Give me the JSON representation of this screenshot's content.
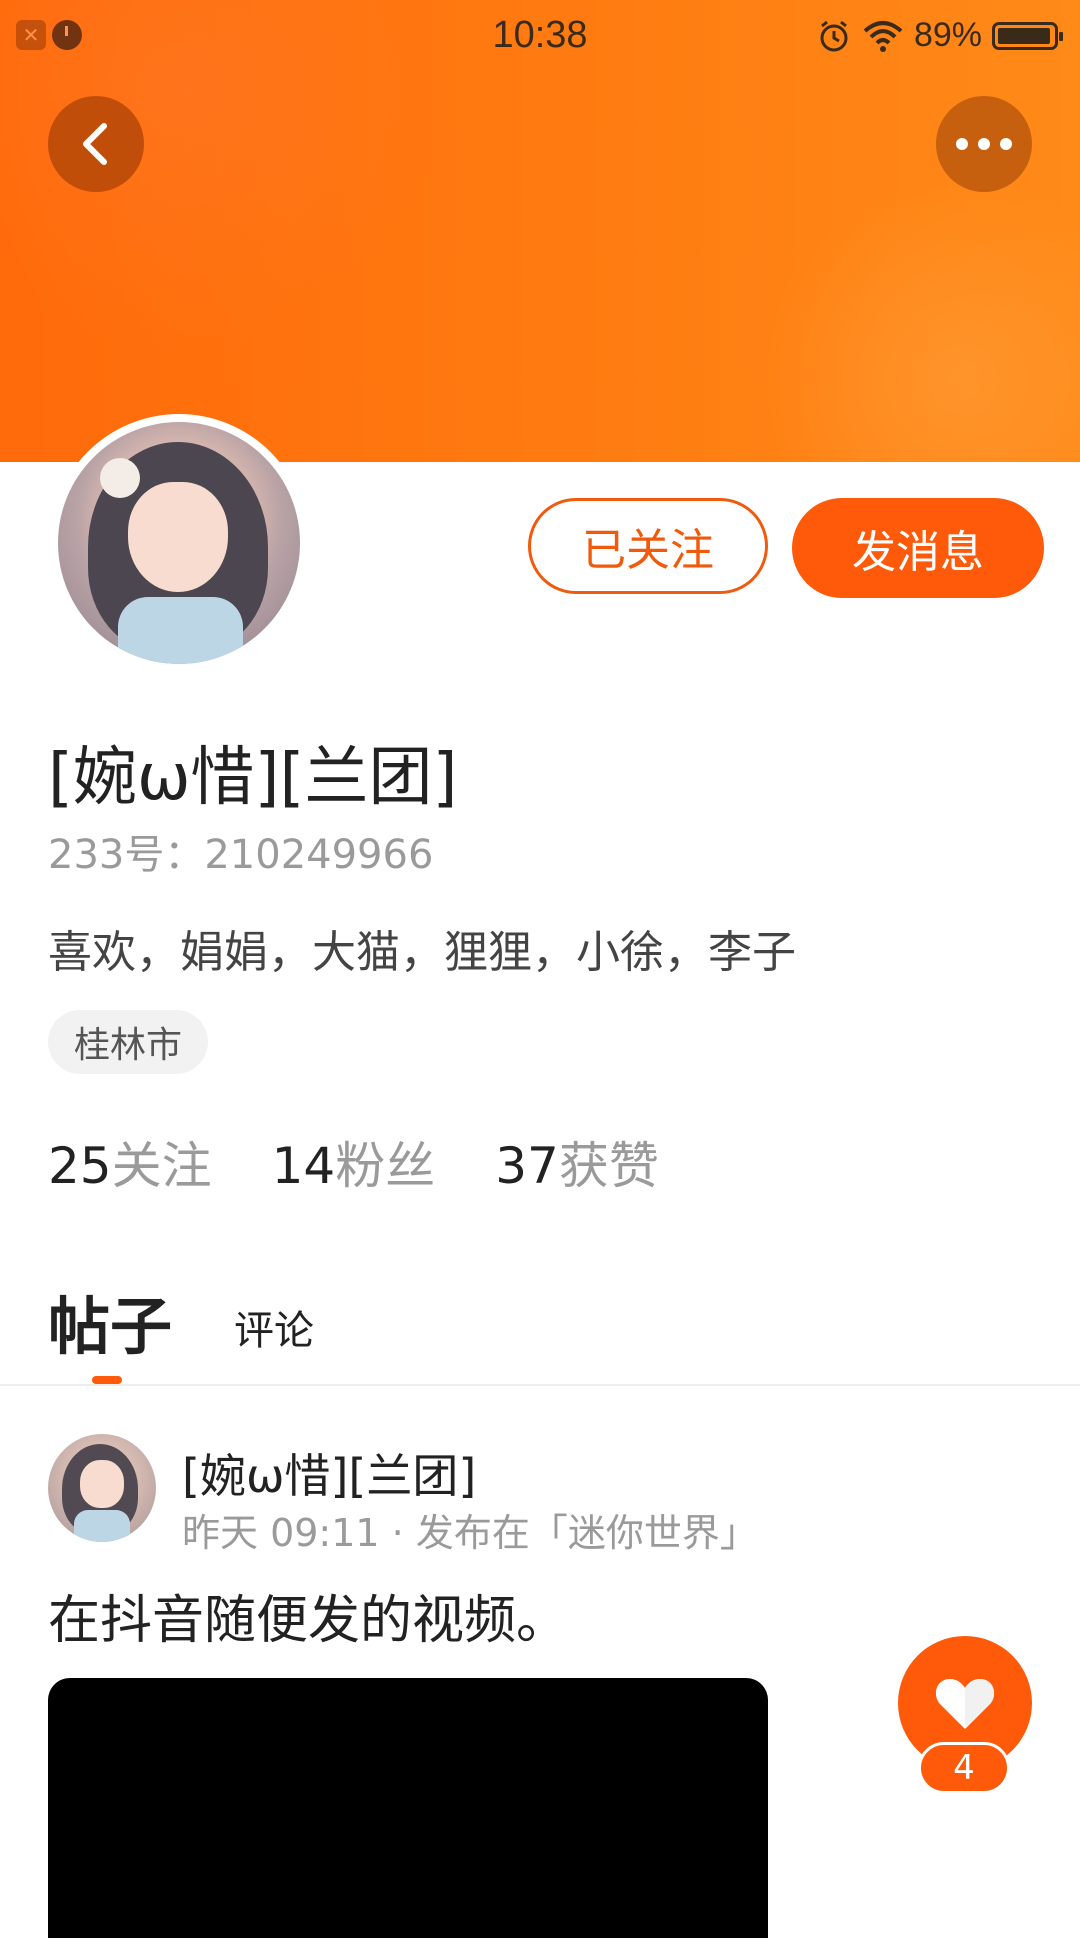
{
  "status_bar": {
    "time": "10:38",
    "battery": "89%",
    "icons": [
      "app-notification-icon",
      "alarm-icon",
      "wifi-icon",
      "battery-icon"
    ]
  },
  "header": {
    "back_icon": "chevron-left-icon",
    "more_icon": "more-dots-icon",
    "banner_color": "#ff7410"
  },
  "profile": {
    "follow_label": "已关注",
    "message_label": "发消息",
    "nickname": "[婉ω惜][兰团]",
    "uid": "233号：210249966",
    "bio": "喜欢，娟娟，大猫，狸狸，小徐，李子",
    "city": "桂林市",
    "stats": [
      {
        "num": "25",
        "label": "关注"
      },
      {
        "num": "14",
        "label": "粉丝"
      },
      {
        "num": "37",
        "label": "获赞"
      }
    ]
  },
  "tabs": [
    {
      "label": "帖子",
      "active": true
    },
    {
      "label": "评论",
      "active": false
    }
  ],
  "post": {
    "author": "[婉ω惜][兰团]",
    "meta": "昨天 09:11 · 发布在「迷你世界」",
    "text": "在抖音随便发的视频。"
  },
  "like": {
    "count": "4"
  },
  "colors": {
    "accent": "#ff5a0a",
    "muted_text": "#9a9a9a"
  }
}
